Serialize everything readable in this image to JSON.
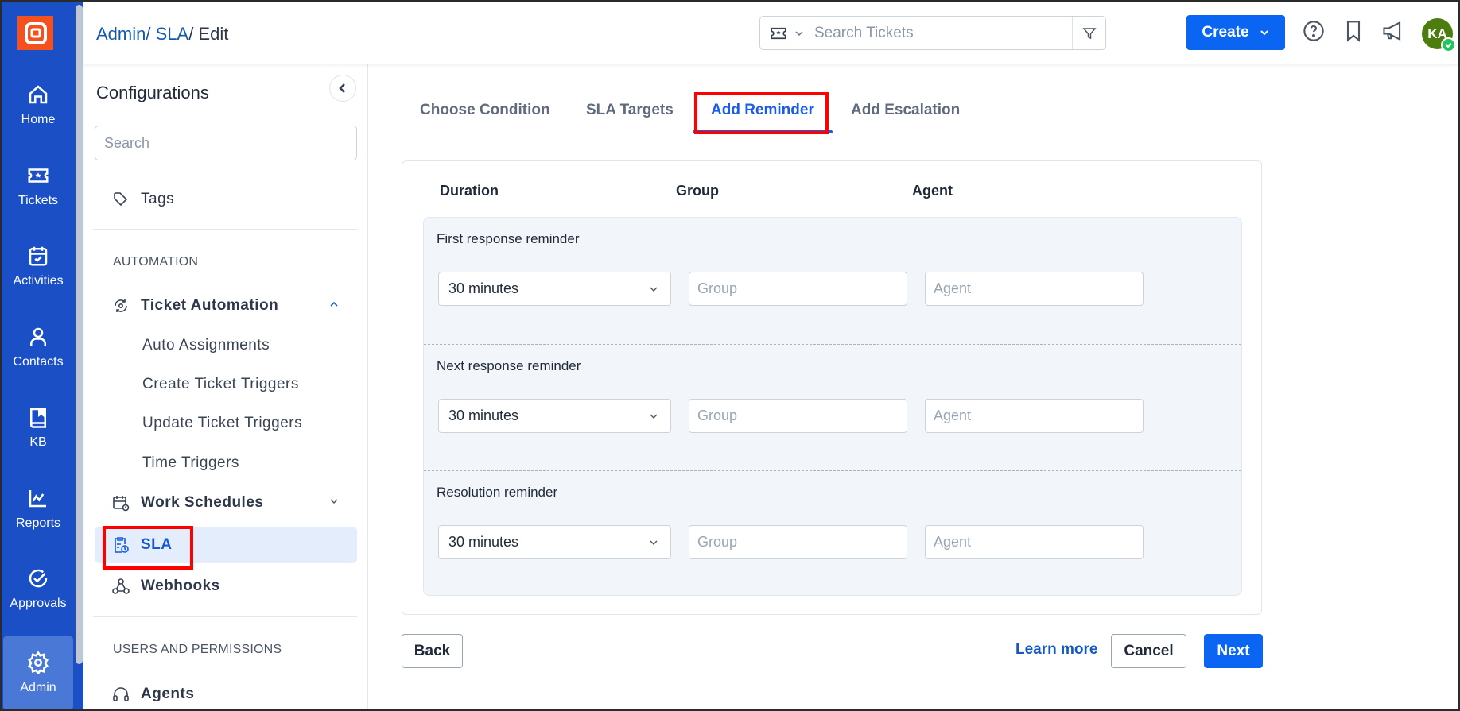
{
  "colors": {
    "nav_bg": "#1a4fc6",
    "accent": "#0a66f2",
    "logo": "#f4511e",
    "avatar": "#4d7c0f",
    "highlight": "#ff0000"
  },
  "left_nav": {
    "logo_icon": "app-logo-icon",
    "items": [
      {
        "label": "Home",
        "icon": "home-icon"
      },
      {
        "label": "Tickets",
        "icon": "ticket-icon"
      },
      {
        "label": "Activities",
        "icon": "calendar-check-icon"
      },
      {
        "label": "Contacts",
        "icon": "user-icon"
      },
      {
        "label": "KB",
        "icon": "book-icon"
      },
      {
        "label": "Reports",
        "icon": "chart-line-icon"
      },
      {
        "label": "Approvals",
        "icon": "check-circle-icon"
      },
      {
        "label": "Admin",
        "icon": "gear-icon",
        "active": true
      }
    ]
  },
  "header": {
    "breadcrumb": [
      {
        "label": "Admin/ ",
        "link": true
      },
      {
        "label": "SLA",
        "link": true
      },
      {
        "label": "/ Edit",
        "link": false
      }
    ],
    "search": {
      "placeholder": "Search Tickets"
    },
    "create_label": "Create",
    "avatar_initials": "KA"
  },
  "config_sidebar": {
    "title": "Configurations",
    "search_placeholder": "Search",
    "items_top": [
      {
        "label": "Tags"
      }
    ],
    "automation_section": "AUTOMATION",
    "ticket_automation": {
      "label": "Ticket Automation",
      "expanded": true,
      "children": [
        "Auto Assignments",
        "Create Ticket Triggers",
        "Update Ticket Triggers",
        "Time Triggers"
      ]
    },
    "work_schedules": "Work Schedules",
    "sla": "SLA",
    "webhooks": "Webhooks",
    "users_section": "USERS AND PERMISSIONS",
    "agents": "Agents"
  },
  "tabs": [
    {
      "label": "Choose Condition"
    },
    {
      "label": "SLA Targets"
    },
    {
      "label": "Add Reminder",
      "active": true
    },
    {
      "label": "Add Escalation"
    }
  ],
  "reminder_form": {
    "columns": {
      "duration": "Duration",
      "group": "Group",
      "agent": "Agent"
    },
    "rows": [
      {
        "label": "First response reminder",
        "duration": "30 minutes",
        "group_placeholder": "Group",
        "agent_placeholder": "Agent"
      },
      {
        "label": "Next response reminder",
        "duration": "30 minutes",
        "group_placeholder": "Group",
        "agent_placeholder": "Agent"
      },
      {
        "label": "Resolution reminder",
        "duration": "30 minutes",
        "group_placeholder": "Group",
        "agent_placeholder": "Agent"
      }
    ]
  },
  "footer": {
    "back_label": "Back",
    "learn_more_label": "Learn more",
    "cancel_label": "Cancel",
    "next_label": "Next"
  }
}
